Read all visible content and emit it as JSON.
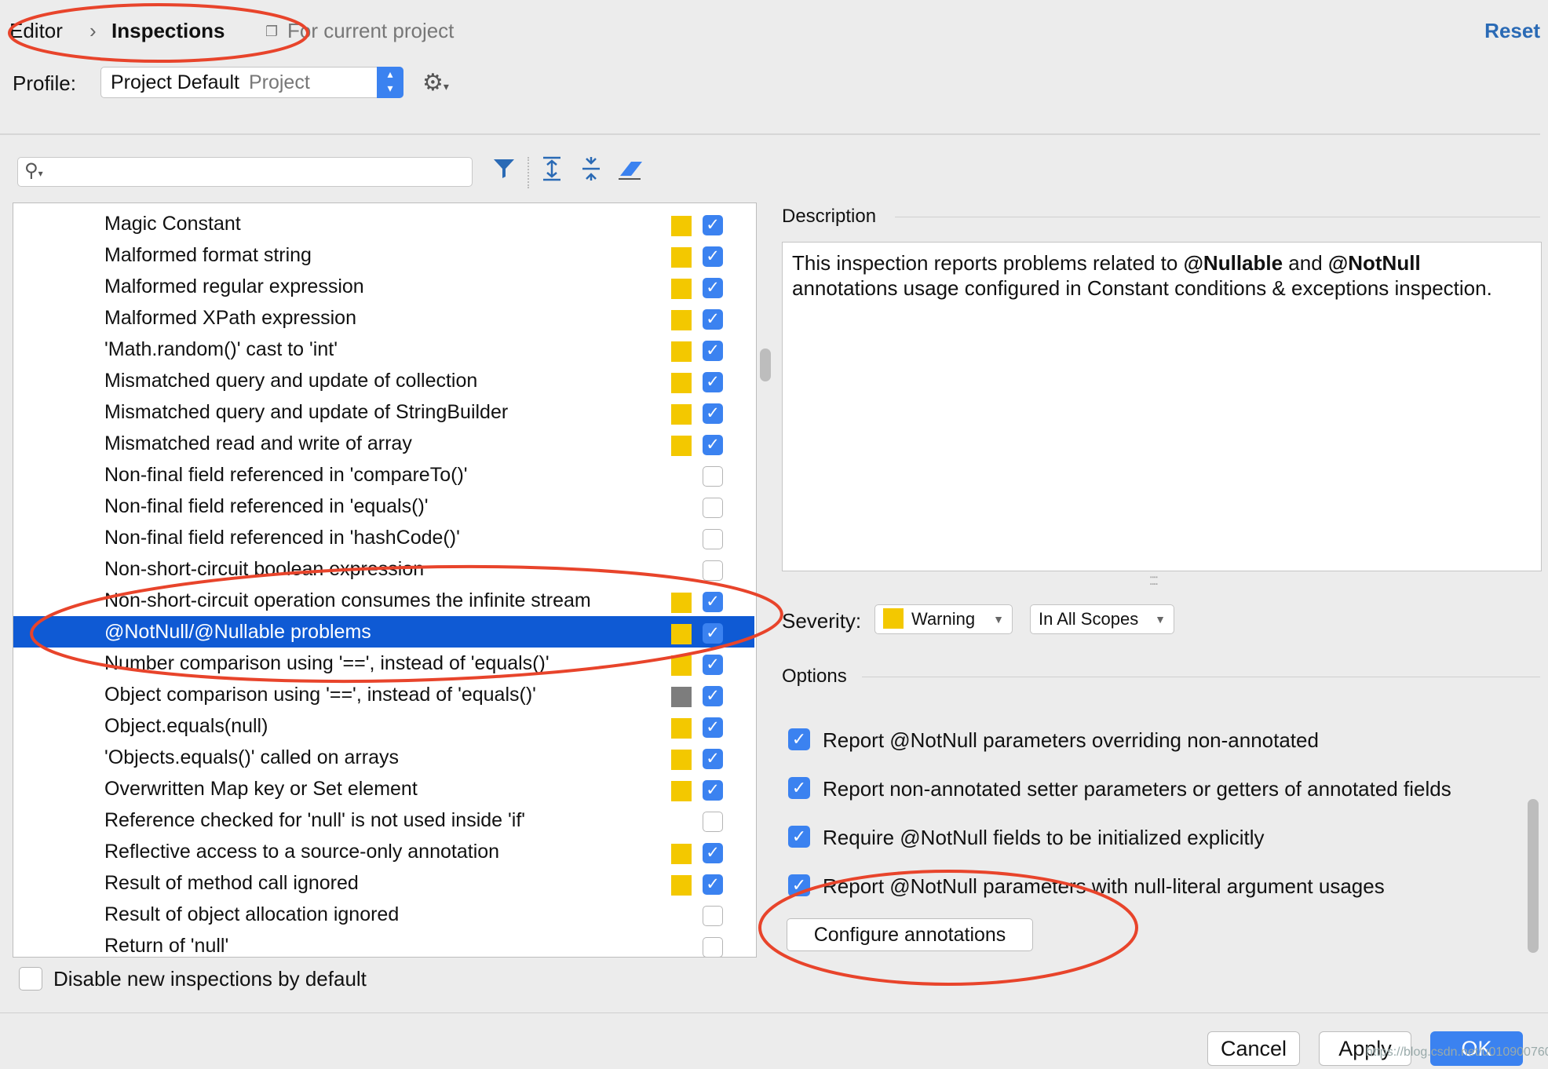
{
  "breadcrumb": {
    "parent": "Editor",
    "current": "Inspections",
    "scope": "For current project"
  },
  "reset": "Reset",
  "profile": {
    "label": "Profile:",
    "value": "Project Default",
    "scope": "Project"
  },
  "search": {
    "placeholder": ""
  },
  "inspections": [
    {
      "label": "Magic Constant",
      "sev": "warning",
      "checked": true
    },
    {
      "label": "Malformed format string",
      "sev": "warning",
      "checked": true
    },
    {
      "label": "Malformed regular expression",
      "sev": "warning",
      "checked": true
    },
    {
      "label": "Malformed XPath expression",
      "sev": "warning",
      "checked": true
    },
    {
      "label": "'Math.random()' cast to 'int'",
      "sev": "warning",
      "checked": true
    },
    {
      "label": "Mismatched query and update of collection",
      "sev": "warning",
      "checked": true
    },
    {
      "label": "Mismatched query and update of StringBuilder",
      "sev": "warning",
      "checked": true
    },
    {
      "label": "Mismatched read and write of array",
      "sev": "warning",
      "checked": true
    },
    {
      "label": "Non-final field referenced in 'compareTo()'",
      "sev": "none",
      "checked": false
    },
    {
      "label": "Non-final field referenced in 'equals()'",
      "sev": "none",
      "checked": false
    },
    {
      "label": "Non-final field referenced in 'hashCode()'",
      "sev": "none",
      "checked": false
    },
    {
      "label": "Non-short-circuit boolean expression",
      "sev": "none",
      "checked": false
    },
    {
      "label": "Non-short-circuit operation consumes the infinite stream",
      "sev": "warning",
      "checked": true
    },
    {
      "label": "@NotNull/@Nullable problems",
      "sev": "warning",
      "checked": true,
      "selected": true
    },
    {
      "label": "Number comparison using '==', instead of 'equals()'",
      "sev": "warning",
      "checked": true
    },
    {
      "label": "Object comparison using '==', instead of 'equals()'",
      "sev": "weak",
      "checked": true
    },
    {
      "label": "Object.equals(null)",
      "sev": "warning",
      "checked": true
    },
    {
      "label": "'Objects.equals()' called on arrays",
      "sev": "warning",
      "checked": true
    },
    {
      "label": "Overwritten Map key or Set element",
      "sev": "warning",
      "checked": true
    },
    {
      "label": "Reference checked for 'null' is not used inside 'if'",
      "sev": "none",
      "checked": false
    },
    {
      "label": "Reflective access to a source-only annotation",
      "sev": "warning",
      "checked": true
    },
    {
      "label": "Result of method call ignored",
      "sev": "warning",
      "checked": true
    },
    {
      "label": "Result of object allocation ignored",
      "sev": "none",
      "checked": false
    },
    {
      "label": "Return of 'null'",
      "sev": "none",
      "checked": false
    }
  ],
  "disable_new": "Disable new inspections by default",
  "description": {
    "title": "Description",
    "text_1": "This inspection reports problems related to ",
    "bold_1": "@Nullable",
    "text_2": " and ",
    "bold_2": "@NotNull",
    "text_3": " annotations usage configured in Constant conditions & exceptions inspection."
  },
  "severity": {
    "label": "Severity:",
    "value": "Warning",
    "scope": "In All Scopes"
  },
  "options": {
    "title": "Options",
    "items": [
      "Report @NotNull parameters overriding non-annotated",
      "Report non-annotated setter parameters or getters of annotated fields",
      "Require @NotNull fields to be initialized explicitly",
      "Report @NotNull parameters with null-literal argument usages"
    ],
    "configure": "Configure annotations"
  },
  "buttons": {
    "cancel": "Cancel",
    "apply": "Apply",
    "ok": "OK"
  },
  "watermark": "https://blog.csdn.net/u010900760",
  "colors": {
    "accent": "#3b82f0",
    "selection": "#0f5ad4",
    "warning": "#f3c800",
    "annotation": "#e8442b"
  }
}
